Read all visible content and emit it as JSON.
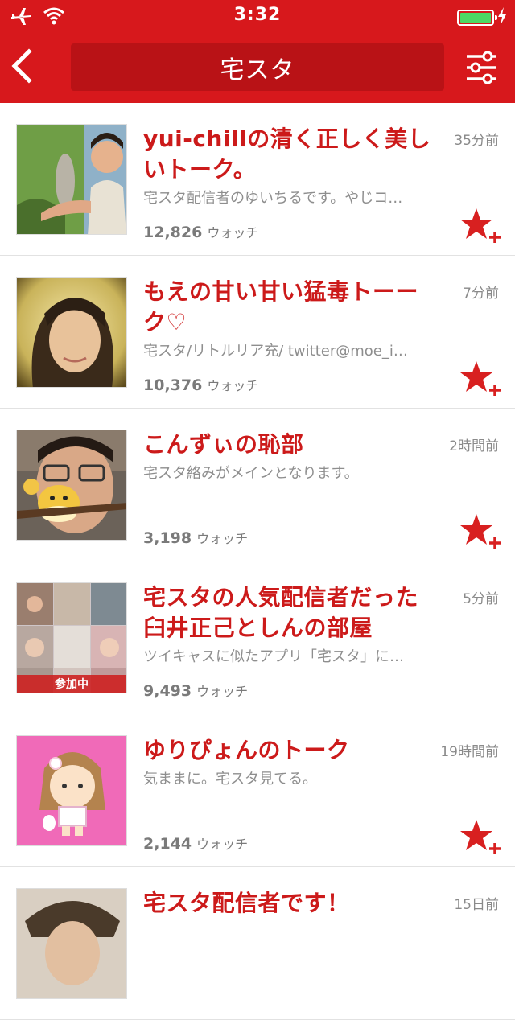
{
  "status_bar": {
    "time": "3:32"
  },
  "nav": {
    "title": "宅スタ"
  },
  "colors": {
    "accent": "#d7181c",
    "title_red": "#cc1a1a",
    "star": "#d82020"
  },
  "watch_label": "ウォッチ",
  "rooms": [
    {
      "title": "yui-chillの清く正しく美しいトーク。",
      "desc": "宅スタ配信者のゆいちるです。やじコ…",
      "watch_count": "12,826",
      "time": "35分前"
    },
    {
      "title": "もえの甘い甘い猛毒トーーク♡",
      "desc": "宅スタ/リトルリア充/ twitter@moe_i…",
      "watch_count": "10,376",
      "time": "7分前"
    },
    {
      "title": "こんずぃの恥部",
      "desc": "宅スタ絡みがメインとなります。",
      "watch_count": "3,198",
      "time": "2時間前"
    },
    {
      "title": "宅スタの人気配信者だった臼井正己としんの部屋",
      "desc": "ツイキャスに似たアプリ「宅スタ」に…",
      "watch_count": "9,493",
      "time": "5分前",
      "badge": "参加中"
    },
    {
      "title": "ゆりぴょんのトーク",
      "desc": "気ままに。宅スタ見てる。",
      "watch_count": "2,144",
      "time": "19時間前"
    },
    {
      "title": "宅スタ配信者です！",
      "desc": "",
      "watch_count": "",
      "time": "15日前"
    }
  ]
}
